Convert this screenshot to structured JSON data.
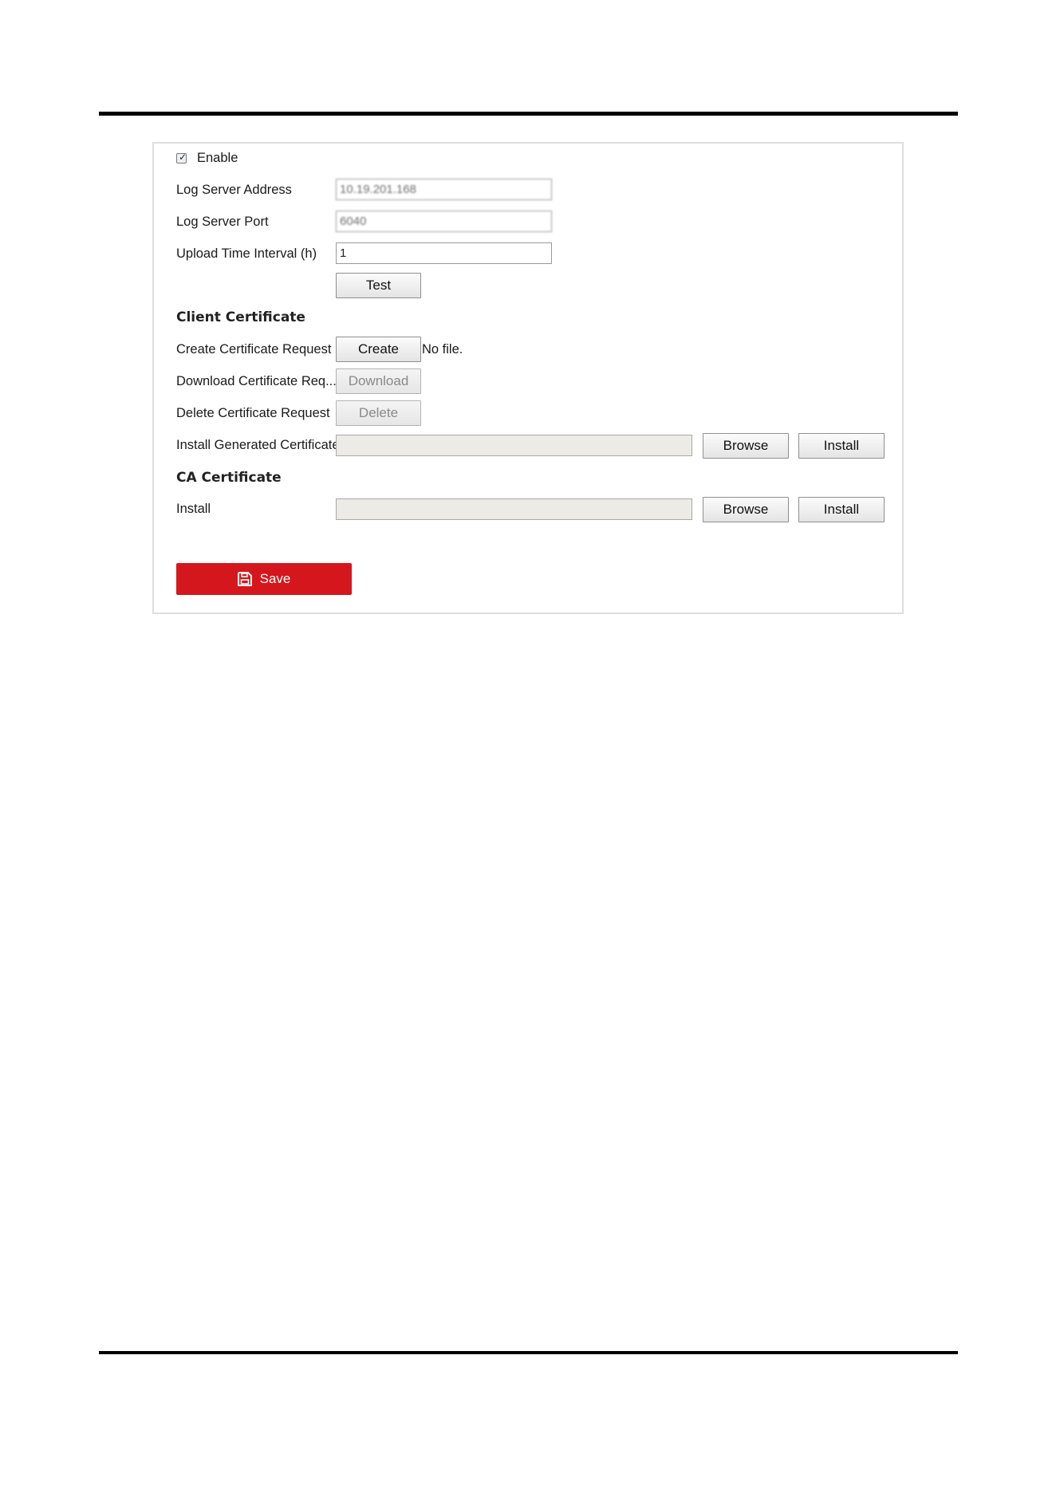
{
  "form": {
    "enable_label": "Enable",
    "enable_checked": true,
    "log_server_address": {
      "label": "Log Server Address",
      "value": "10.19.201.168"
    },
    "log_server_port": {
      "label": "Log Server Port",
      "value": "6040"
    },
    "upload_interval": {
      "label": "Upload Time Interval (h)",
      "value": "1"
    },
    "test_label": "Test"
  },
  "client_certificate": {
    "heading": "Client Certificate",
    "create_request_label": "Create Certificate Request",
    "create_button": "Create",
    "no_file_text": "No file.",
    "download_request_label": "Download Certificate Req...",
    "download_button": "Download",
    "delete_request_label": "Delete Certificate Request",
    "delete_button": "Delete",
    "install_generated_label": "Install Generated Certificate",
    "browse_button": "Browse",
    "install_button": "Install"
  },
  "ca_certificate": {
    "heading": "CA Certificate",
    "install_label": "Install",
    "browse_button": "Browse",
    "install_button": "Install"
  },
  "footer": {
    "save_label": "Save"
  },
  "colors": {
    "save_button": "#d4171d",
    "panel_border": "#dedede"
  },
  "icons": {
    "save": "floppy-disk-icon",
    "check": "checkmark-icon"
  }
}
